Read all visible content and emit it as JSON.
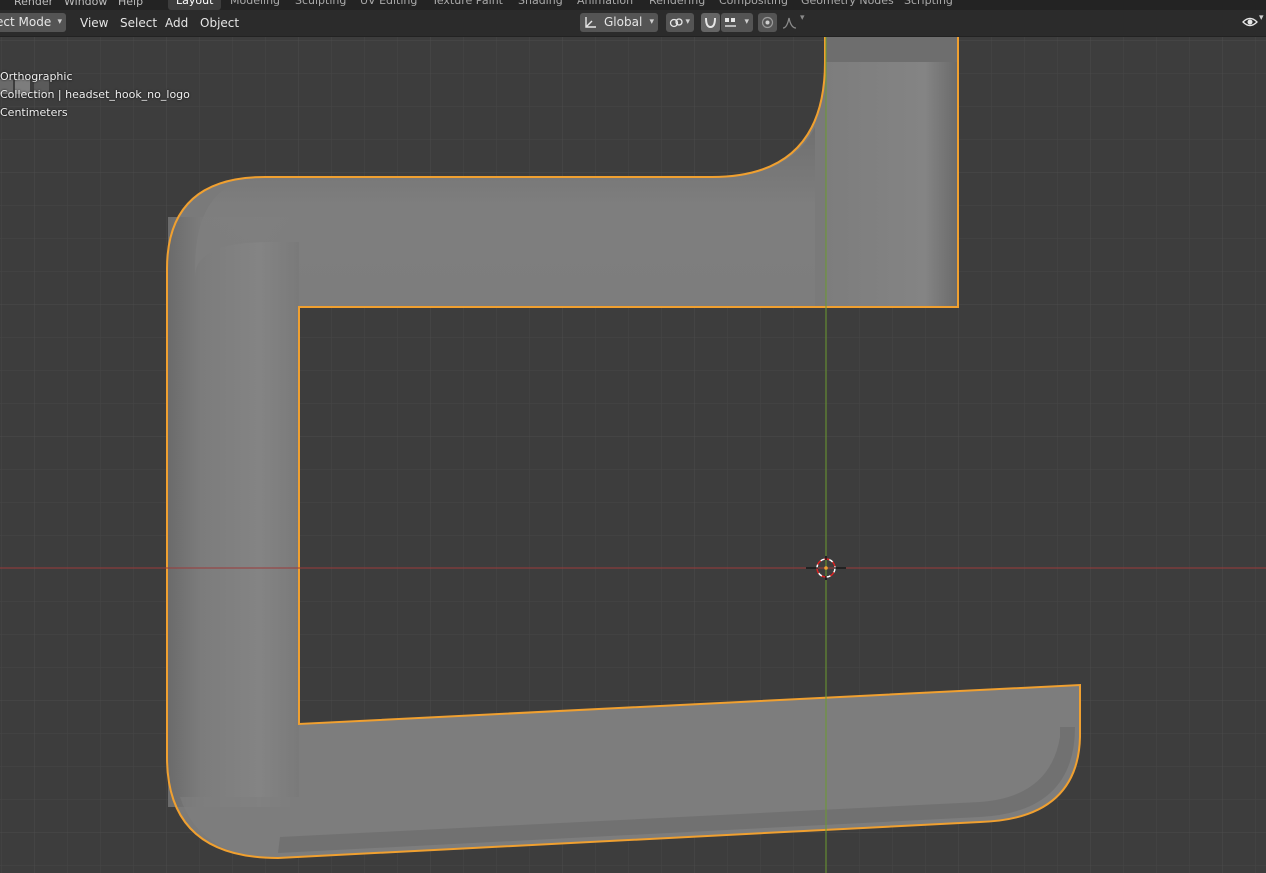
{
  "topbar": {
    "menus": [
      "Render",
      "Window",
      "Help"
    ],
    "workspaces": [
      "Layout",
      "Modeling",
      "Sculpting",
      "UV Editing",
      "Texture Paint",
      "Shading",
      "Animation",
      "Rendering",
      "Compositing",
      "Geometry Nodes",
      "Scripting"
    ],
    "active_workspace": "Layout"
  },
  "header": {
    "mode": "ect Mode",
    "menus": [
      "View",
      "Select",
      "Add",
      "Object"
    ],
    "orientation": "Global"
  },
  "viewport": {
    "view_name": "Orthographic",
    "collection": "Collection | headset_hook_no_logo",
    "units": "Centimeters"
  },
  "colors": {
    "background": "#3d3d3d",
    "grid": "#474747",
    "x_axis": "#9b3a3a",
    "y_axis": "#6b9a2e",
    "selection_outline": "#f0a030",
    "mesh": "#7a7a7a"
  }
}
